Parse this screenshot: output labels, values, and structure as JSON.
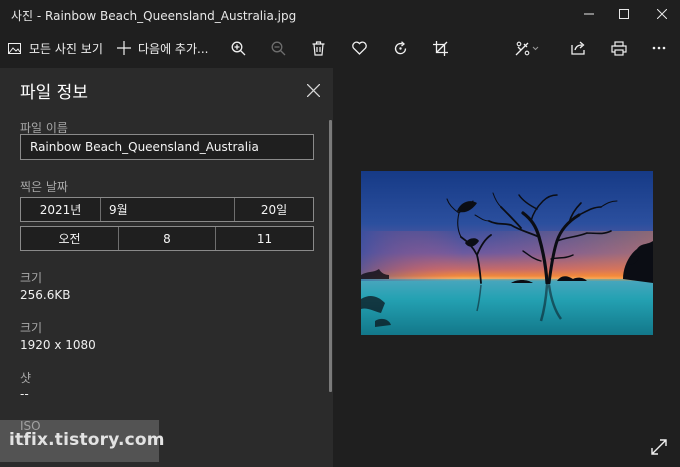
{
  "window": {
    "title": "사진 - Rainbow Beach_Queensland_Australia.jpg",
    "minimize_icon": "minimize-icon",
    "maximize_icon": "maximize-icon",
    "close_icon": "close-icon"
  },
  "toolbar": {
    "see_all_label": "모든 사진 보기",
    "add_to_label": "다음에 추가...",
    "icons": [
      "photos-icon",
      "plus-icon",
      "zoom-in-icon",
      "zoom-out-icon",
      "trash-icon",
      "heart-icon",
      "rotate-icon",
      "crop-icon",
      "edit-icon",
      "share-icon",
      "print-icon",
      "more-icon"
    ]
  },
  "file_info": {
    "title": "파일 정보",
    "name_label": "파일 이름",
    "name_value": "Rainbow Beach_Queensland_Australia",
    "date_label": "찍은 날짜",
    "year": "2021년",
    "month": "9월",
    "day": "20일",
    "ampm": "오전",
    "hour": "8",
    "minute": "11",
    "size_label": "크기",
    "size_value": "256.6KB",
    "dimensions_label": "크기",
    "dimensions_value": "1920 x 1080",
    "shutter_label": "샷",
    "shutter_value": "--",
    "iso_label": "ISO",
    "iso_value": "--"
  },
  "watermark": {
    "text": "itfix.tistory.com"
  },
  "colors": {
    "background": "#1f1f1f",
    "panel": "#2b2b2b",
    "sky_top": "#1c3f8c",
    "horizon_orange": "#f08a3a",
    "water": "#1fa0b0"
  }
}
